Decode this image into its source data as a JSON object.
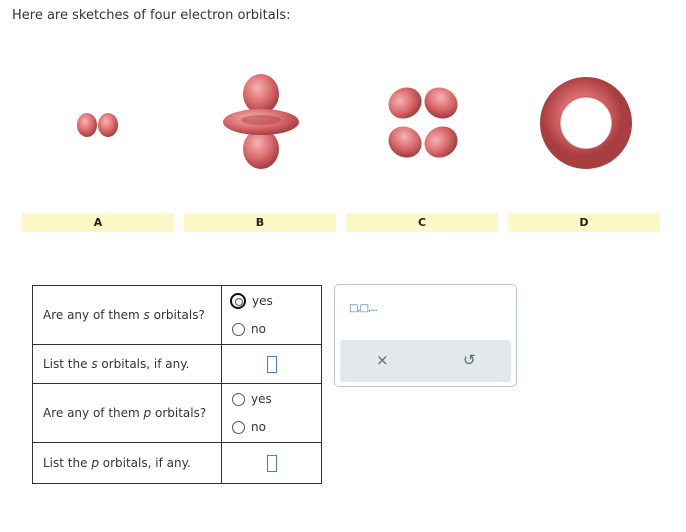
{
  "intro": "Here are sketches of four electron orbitals:",
  "orbital_labels": [
    "A",
    "B",
    "C",
    "D"
  ],
  "questions": [
    {
      "text": "Are any of them ",
      "italic": "s",
      "tail": " orbitals?",
      "options": [
        "yes",
        "no"
      ]
    },
    {
      "text": "List the ",
      "italic": "s",
      "tail": " orbitals, if any."
    },
    {
      "text": "Are any of them ",
      "italic": "p",
      "tail": " orbitals?",
      "options": [
        "yes",
        "no"
      ]
    },
    {
      "text": "List the ",
      "italic": "p",
      "tail": " orbitals, if any."
    }
  ],
  "tool_panel": {
    "symbols": "□,□,...",
    "clear": "×",
    "undo": "↺"
  },
  "colors": {
    "lobe": "#d9696b",
    "label_bar": "#fdf8c8",
    "input_border": "#4a7bd4"
  }
}
